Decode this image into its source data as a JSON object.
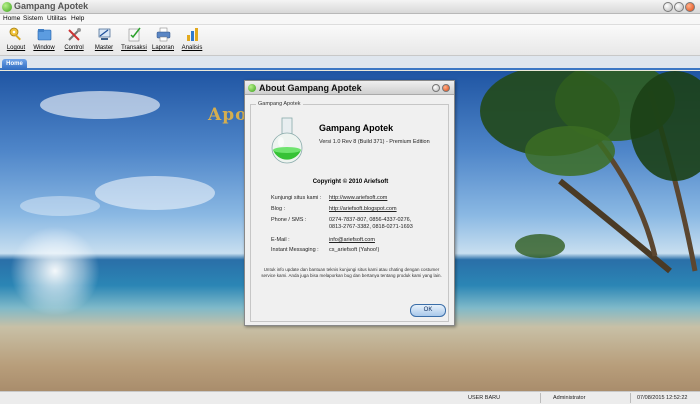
{
  "window": {
    "title": "Gampang Apotek"
  },
  "menu": [
    "Home",
    "Sistem",
    "Utilitas",
    "Help"
  ],
  "toolbar": [
    {
      "label": "Logout",
      "icon": "key-icon"
    },
    {
      "label": "Window",
      "icon": "folder-icon"
    },
    {
      "label": "Control",
      "icon": "tools-icon"
    },
    {
      "label": "Master",
      "icon": "pc-tools-icon"
    },
    {
      "label": "Transaksi",
      "icon": "checklist-icon"
    },
    {
      "label": "Laporan",
      "icon": "printer-icon"
    },
    {
      "label": "Analisis",
      "icon": "chart-icon"
    }
  ],
  "tabs": [
    {
      "label": "Home"
    }
  ],
  "background": {
    "logo_text": "Apo                               ah"
  },
  "about": {
    "title": "About Gampang Apotek",
    "group_title": "Gampang Apotek",
    "product_name": "Gampang Apotek",
    "version": "Versi 1.0 Rev 8 (Build 371) - Premium Edition",
    "copyright": "Copyright © 2010 Ariefsoft",
    "rows": [
      {
        "label": "Kunjungi situs kami :",
        "value": "http://www.ariefsoft.com",
        "link": true
      },
      {
        "label": "Blog :",
        "value": "http://ariefsoft.blogspot.com",
        "link": true
      },
      {
        "label": "Phone / SMS :",
        "value": "0274-7837-807, 0856-4337-0276,",
        "link": false
      },
      {
        "label": "",
        "value": "0813-2767-3382, 0818-0271-1693",
        "link": false
      },
      {
        "label": "E-Mail :",
        "value": "info@ariefsoft.com",
        "link": true
      },
      {
        "label": "Instant Messaging :",
        "value": "cs_ariefsoft (Yahoo!)",
        "link": false
      }
    ],
    "footer_note": "Untuk info update dan bantuan teknis kunjungi situs kami atau chating dengan costumer service kami. Anda juga bisa melaporkan  bug dan bertanya tentang produk kami yang lain.",
    "ok_label": "OK"
  },
  "status": {
    "user": "USER BARU",
    "role": "Administrator",
    "datetime": "07/08/2015  12:52:22"
  }
}
